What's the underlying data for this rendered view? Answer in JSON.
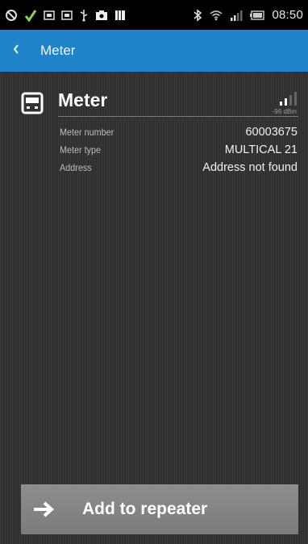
{
  "status_bar": {
    "time": "08:50",
    "left_icons": [
      "sync-icon",
      "usb-debug-icon",
      "screenshot-icon",
      "screenshot-icon",
      "usb-icon",
      "camera-icon",
      "barcode-icon"
    ],
    "right_icons": [
      "bluetooth-icon",
      "wifi-icon",
      "cell-signal-icon",
      "battery-icon"
    ]
  },
  "app_bar": {
    "title": "Meter",
    "back_icon": "chevron-left-icon",
    "color": "#1e83c9"
  },
  "meter": {
    "title": "Meter",
    "icon": "meter-device-icon",
    "signal": {
      "label": "-96 dBm",
      "bars_filled": 2,
      "bars_total": 4
    },
    "details": [
      {
        "label": "Meter number",
        "value": "60003675"
      },
      {
        "label": "Meter type",
        "value": "MULTICAL 21"
      },
      {
        "label": "Address",
        "value": "Address not found"
      }
    ]
  },
  "action": {
    "label": "Add to repeater",
    "icon": "arrow-right-icon"
  }
}
